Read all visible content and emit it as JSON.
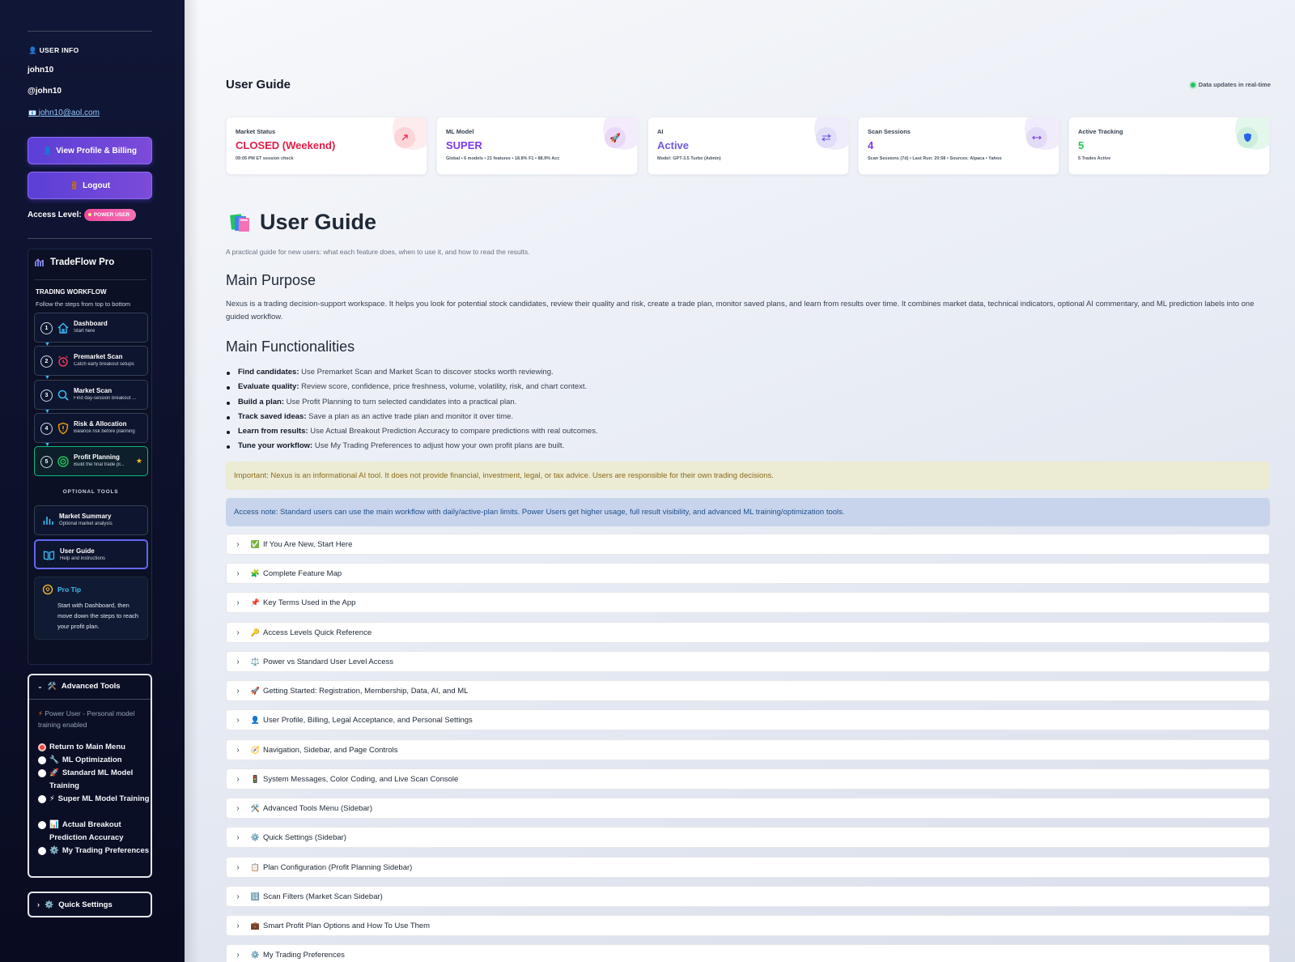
{
  "sidebar": {
    "user_info": {
      "heading": "USER INFO",
      "username": "john10",
      "handle": "@john10",
      "email": "john10@aol.com"
    },
    "view_profile_label": "View Profile & Billing",
    "logout_label": "Logout",
    "access_level_label": "Access Level:",
    "access_level_badge": "POWER USER",
    "brand": "TradeFlow Pro",
    "workflow": {
      "heading": "TRADING WORKFLOW",
      "subheading": "Follow the steps from top to bottom",
      "steps": [
        {
          "num": "1",
          "title": "Dashboard",
          "sub": "Start here",
          "icon": "home-icon"
        },
        {
          "num": "2",
          "title": "Premarket Scan",
          "sub": "Catch early breakout setups",
          "icon": "alarm-clock-icon"
        },
        {
          "num": "3",
          "title": "Market Scan",
          "sub": "Find day-session breakout ...",
          "icon": "search-icon"
        },
        {
          "num": "4",
          "title": "Risk & Allocation",
          "sub": "Balance risk before planning",
          "icon": "shield-icon"
        },
        {
          "num": "5",
          "title": "Profit Planning",
          "sub": "Build the final trade pl...",
          "icon": "target-icon"
        }
      ]
    },
    "optional_tools": {
      "heading": "OPTIONAL TOOLS",
      "items": [
        {
          "title": "Market Summary",
          "sub": "Optional market analysis",
          "icon": "bar-chart-icon"
        },
        {
          "title": "User Guide",
          "sub": "Help and instructions",
          "icon": "book-icon"
        }
      ]
    },
    "pro_tip": {
      "title": "Pro Tip",
      "text": "Start with Dashboard, then move down the steps to reach your profit plan."
    },
    "advanced_tools": {
      "title": "Advanced Tools",
      "note": "Power User - Personal model training enabled",
      "options": [
        {
          "label": "Return to Main Menu",
          "icon": "",
          "selected": true
        },
        {
          "label": "ML Optimization",
          "icon": "🔧",
          "selected": false
        },
        {
          "label": "Standard ML Model Training",
          "icon": "🚀",
          "selected": false
        },
        {
          "label": "Super ML Model Training",
          "icon": "⚡",
          "selected": false
        },
        {
          "label": "Actual Breakout Prediction Accuracy",
          "icon": "📊",
          "selected": false
        },
        {
          "label": "My Trading Preferences",
          "icon": "⚙️",
          "selected": false
        }
      ]
    },
    "quick_settings_label": "Quick Settings"
  },
  "header": {
    "title": "User Guide",
    "live_text": "Data updates in real-time"
  },
  "cards": [
    {
      "label": "Market Status",
      "value": "CLOSED (Weekend)",
      "sub": "09:05 PM ET session check",
      "value_color": "#e11d48",
      "accent": "#fde2e4",
      "icon": "trend-up-icon"
    },
    {
      "label": "ML Model",
      "value": "SUPER",
      "sub": "Global • 6 models • 21 features • 18.8% F1 • 88.9% Acc",
      "value_color": "#7c3aed",
      "accent": "#f3e8ff",
      "icon": "rocket-icon"
    },
    {
      "label": "AI",
      "value": "Active",
      "sub": "Model: GPT-3.5 Turbo (Admin)",
      "value_color": "#6d5ae6",
      "accent": "#ede9fe",
      "icon": "swap-icon"
    },
    {
      "label": "Scan Sessions",
      "value": "4",
      "sub": "Scan Sessions (7d) • Last Run: 20:58 • Sources: Alpaca • Yahoo",
      "value_color": "#7c3aed",
      "accent": "#ede9fe",
      "icon": "scan-icon"
    },
    {
      "label": "Active Tracking",
      "value": "5",
      "sub": "5 Trades Active",
      "value_color": "#22c55e",
      "accent": "#dcfce7",
      "icon": "shield-icon"
    }
  ],
  "guide": {
    "title": "User Guide",
    "subtitle": "A practical guide for new users: what each feature does, when to use it, and how to read the results.",
    "purpose_heading": "Main Purpose",
    "purpose_text": "Nexus is a trading decision-support workspace. It helps you look for potential stock candidates, review their quality and risk, create a trade plan, monitor saved plans, and learn from results over time. It combines market data, technical indicators, optional AI commentary, and ML prediction labels into one guided workflow.",
    "functionalities_heading": "Main Functionalities",
    "functionalities": [
      {
        "bold": "Find candidates:",
        "text": " Use Premarket Scan and Market Scan to discover stocks worth reviewing."
      },
      {
        "bold": "Evaluate quality:",
        "text": " Review score, confidence, price freshness, volume, volatility, risk, and chart context."
      },
      {
        "bold": "Build a plan:",
        "text": " Use Profit Planning to turn selected candidates into a practical plan."
      },
      {
        "bold": "Track saved ideas:",
        "text": " Save a plan as an active trade plan and monitor it over time."
      },
      {
        "bold": "Learn from results:",
        "text": " Use Actual Breakout Prediction Accuracy to compare predictions with real outcomes."
      },
      {
        "bold": "Tune your workflow:",
        "text": " Use My Trading Preferences to adjust how your own profit plans are built."
      }
    ],
    "warning": "Important: Nexus is an informational AI tool. It does not provide financial, investment, legal, or tax advice. Users are responsible for their own trading decisions.",
    "access_note": "Access note: Standard users can use the main workflow with daily/active-plan limits. Power Users get higher usage, full result visibility, and advanced ML training/optimization tools.",
    "sections": [
      {
        "emoji": "✅",
        "label": "If You Are New, Start Here"
      },
      {
        "emoji": "🧩",
        "label": "Complete Feature Map"
      },
      {
        "emoji": "📌",
        "label": "Key Terms Used in the App"
      },
      {
        "emoji": "🔑",
        "label": "Access Levels Quick Reference"
      },
      {
        "emoji": "⚖️",
        "label": "Power vs Standard User Level Access"
      },
      {
        "emoji": "🚀",
        "label": "Getting Started: Registration, Membership, Data, AI, and ML"
      },
      {
        "emoji": "👤",
        "label": "User Profile, Billing, Legal Acceptance, and Personal Settings"
      },
      {
        "emoji": "🧭",
        "label": "Navigation, Sidebar, and Page Controls"
      },
      {
        "emoji": "🚦",
        "label": "System Messages, Color Coding, and Live Scan Console"
      },
      {
        "emoji": "🛠️",
        "label": "Advanced Tools Menu (Sidebar)"
      },
      {
        "emoji": "⚙️",
        "label": "Quick Settings (Sidebar)"
      },
      {
        "emoji": "📋",
        "label": "Plan Configuration (Profit Planning Sidebar)"
      },
      {
        "emoji": "🔢",
        "label": "Scan Filters (Market Scan Sidebar)"
      },
      {
        "emoji": "💼",
        "label": "Smart Profit Plan Options and How To Use Them"
      },
      {
        "emoji": "⚙️",
        "label": "My Trading Preferences"
      }
    ]
  }
}
